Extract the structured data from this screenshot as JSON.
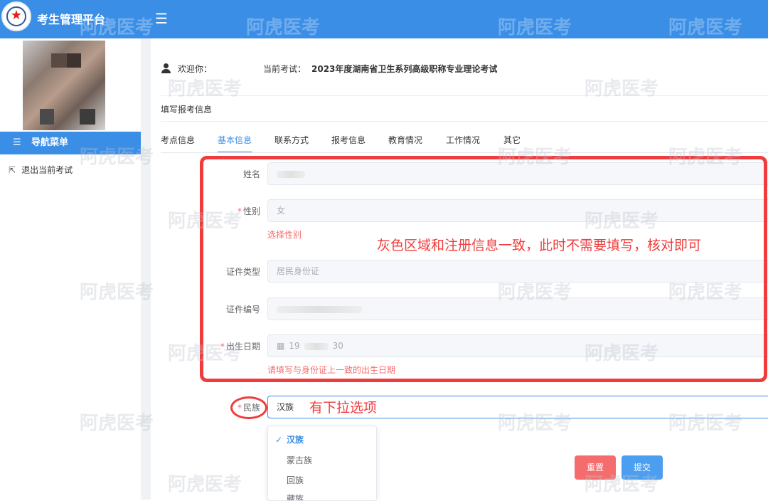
{
  "app": {
    "title": "考生管理平台",
    "menu_icon": "hamburger-icon"
  },
  "sidebar": {
    "avatar": "blurred-photo",
    "nav_menu_label": "导航菜单",
    "exit_label": "退出当前考试"
  },
  "header": {
    "welcome": "欢迎你：",
    "exam_label": "当前考试：",
    "exam_name": "2023年度湖南省卫生系列高级职称专业理论考试"
  },
  "section_title": "填写报考信息",
  "tabs": [
    "考点信息",
    "基本信息",
    "联系方式",
    "报考信息",
    "教育情况",
    "工作情况",
    "其它"
  ],
  "active_tab": "基本信息",
  "form": {
    "name_label": "姓名",
    "gender_label": "性别",
    "gender_value": "女",
    "gender_hint": "选择性别",
    "id_type_label": "证件类型",
    "id_type_value": "居民身份证",
    "id_number_label": "证件编号",
    "birth_label": "出生日期",
    "birth_value_start": "19",
    "birth_value_end": "30",
    "birth_hint": "请填写与身份证上一致的出生日期",
    "ethnicity_label": "民族",
    "ethnicity_value": "汉族",
    "ethnicity_options": [
      "汉族",
      "蒙古族",
      "回族",
      "藏族"
    ]
  },
  "buttons": {
    "reset": "重置",
    "submit": "提交"
  },
  "annotations": {
    "gray_area_note": "灰色区域和注册信息一致，此时不需要填写，核对即可",
    "dropdown_note": "有下拉选项"
  },
  "watermark": "阿虎医考",
  "colors": {
    "primary": "#3a8ee6",
    "danger": "#f56c6c",
    "annotation": "#f03c3c"
  }
}
